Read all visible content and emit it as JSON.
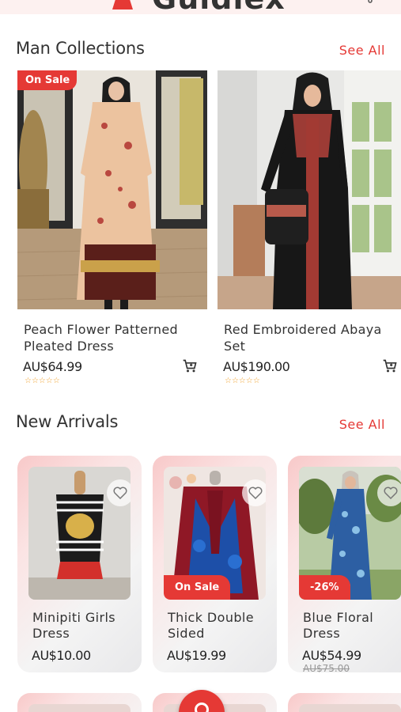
{
  "header": {
    "brand": "Guidlex"
  },
  "man_collections": {
    "title": "Man Collections",
    "see_all": "See All",
    "items": [
      {
        "badge": "On Sale",
        "name": "Peach Flower Patterned Pleated Dress",
        "price": "AU$64.99",
        "stars": "☆☆☆☆☆"
      },
      {
        "badge": "",
        "name": "Red  Embroidered  Abaya Set",
        "price": "AU$190.00",
        "stars": "☆☆☆☆☆"
      }
    ]
  },
  "new_arrivals": {
    "title": "New Arrivals",
    "see_all": "See All",
    "items": [
      {
        "badge": "",
        "name": "Minipiti Girls Dress",
        "price": "AU$10.00",
        "old_price": ""
      },
      {
        "badge": "On Sale",
        "name": "Thick Double Sided",
        "price": "AU$19.99",
        "old_price": ""
      },
      {
        "badge": "-26%",
        "name": "Blue Floral Dress",
        "price": "AU$54.99",
        "old_price": "AU$75.00"
      }
    ]
  },
  "colors": {
    "accent": "#e53935",
    "star": "#f0a02a",
    "header_bg": "#fdf1f0"
  },
  "icons": [
    "menu-icon",
    "logo-dress-icon",
    "cart-icon",
    "add-to-cart-icon",
    "heart-icon",
    "search-icon"
  ]
}
